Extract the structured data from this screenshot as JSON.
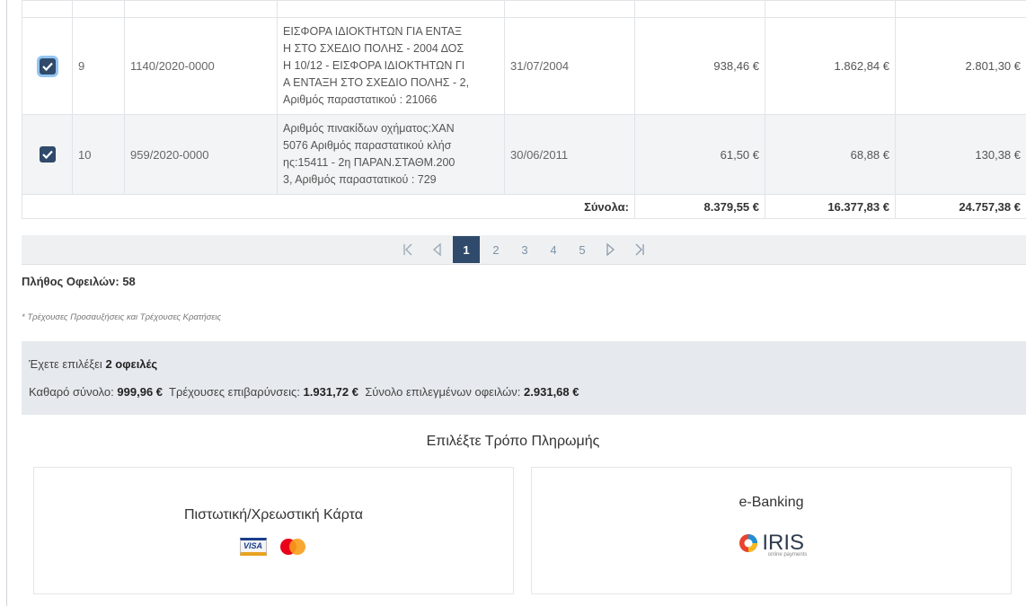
{
  "table": {
    "rows": [
      {
        "no": "9",
        "ref": "1140/2020-0000",
        "description": [
          "ΕΙΣΦΟΡΑ ΙΔΙΟΚΤΗΤΩΝ ΓΙΑ ΕΝΤΑΞ",
          "Η ΣΤΟ ΣΧΕΔΙΟ ΠΟΛΗΣ - 2004 ΔΟΣ",
          "Η 10/12 - ΕΙΣΦΟΡΑ ΙΔΙΟΚΤΗΤΩΝ ΓΙ",
          "Α ΕΝΤΑΞΗ ΣΤΟ ΣΧΕΔΙΟ ΠΟΛΗΣ - 2,",
          "Αριθμός παραστατικού : 21066"
        ],
        "date": "31/07/2004",
        "amount1": "938,46 €",
        "amount2": "1.862,84 €",
        "amount3": "2.801,30 €",
        "checked": true
      },
      {
        "no": "10",
        "ref": "959/2020-0000",
        "description": [
          "Αριθμός πινακίδων οχήματος:ΧΑΝ",
          "5076 Αριθμός παραστατικού κλήσ",
          "ης:15411 - 2η ΠΑΡΑΝ.ΣΤΑΘΜ.200",
          "3, Αριθμός παραστατικού : 729"
        ],
        "date": "30/06/2011",
        "amount1": "61,50 €",
        "amount2": "68,88 €",
        "amount3": "130,38 €",
        "checked": true
      }
    ],
    "totals": {
      "label": "Σύνολα:",
      "amount1": "8.379,55 €",
      "amount2": "16.377,83 €",
      "amount3": "24.757,38 €"
    }
  },
  "pager": {
    "pages": [
      "1",
      "2",
      "3",
      "4",
      "5"
    ],
    "current": "1"
  },
  "debt_count_label": "Πλήθος Οφειλών: 58",
  "footnote": "* Τρέχουσες Προσαυξήσεις και Τρέχουσες Κρατήσεις",
  "summary": {
    "selected_prefix": "Έχετε επιλέξει",
    "selected_value": "2 οφειλές",
    "net_label": "Καθαρό σύνολο:",
    "net_value": "999,96 €",
    "surcharge_label": "Τρέχουσες επιβαρύνσεις:",
    "surcharge_value": "1.931,72 €",
    "total_label": "Σύνολο επιλεγμένων οφειλών:",
    "total_value": "2.931,68 €"
  },
  "payment": {
    "title": "Επιλέξτε Τρόπο Πληρωμής",
    "card_option": "Πιστωτική/Χρεωστική Κάρτα",
    "ebanking_option": "e-Banking",
    "visa_logo": "VISA",
    "iris_logo": "IRIS",
    "iris_sub": "online payments"
  },
  "colors": {
    "accent": "#2f4a6b",
    "summary_bg": "#e6eaee",
    "mastercard_red": "#eb001b",
    "mastercard_orange": "#f79e1b"
  }
}
